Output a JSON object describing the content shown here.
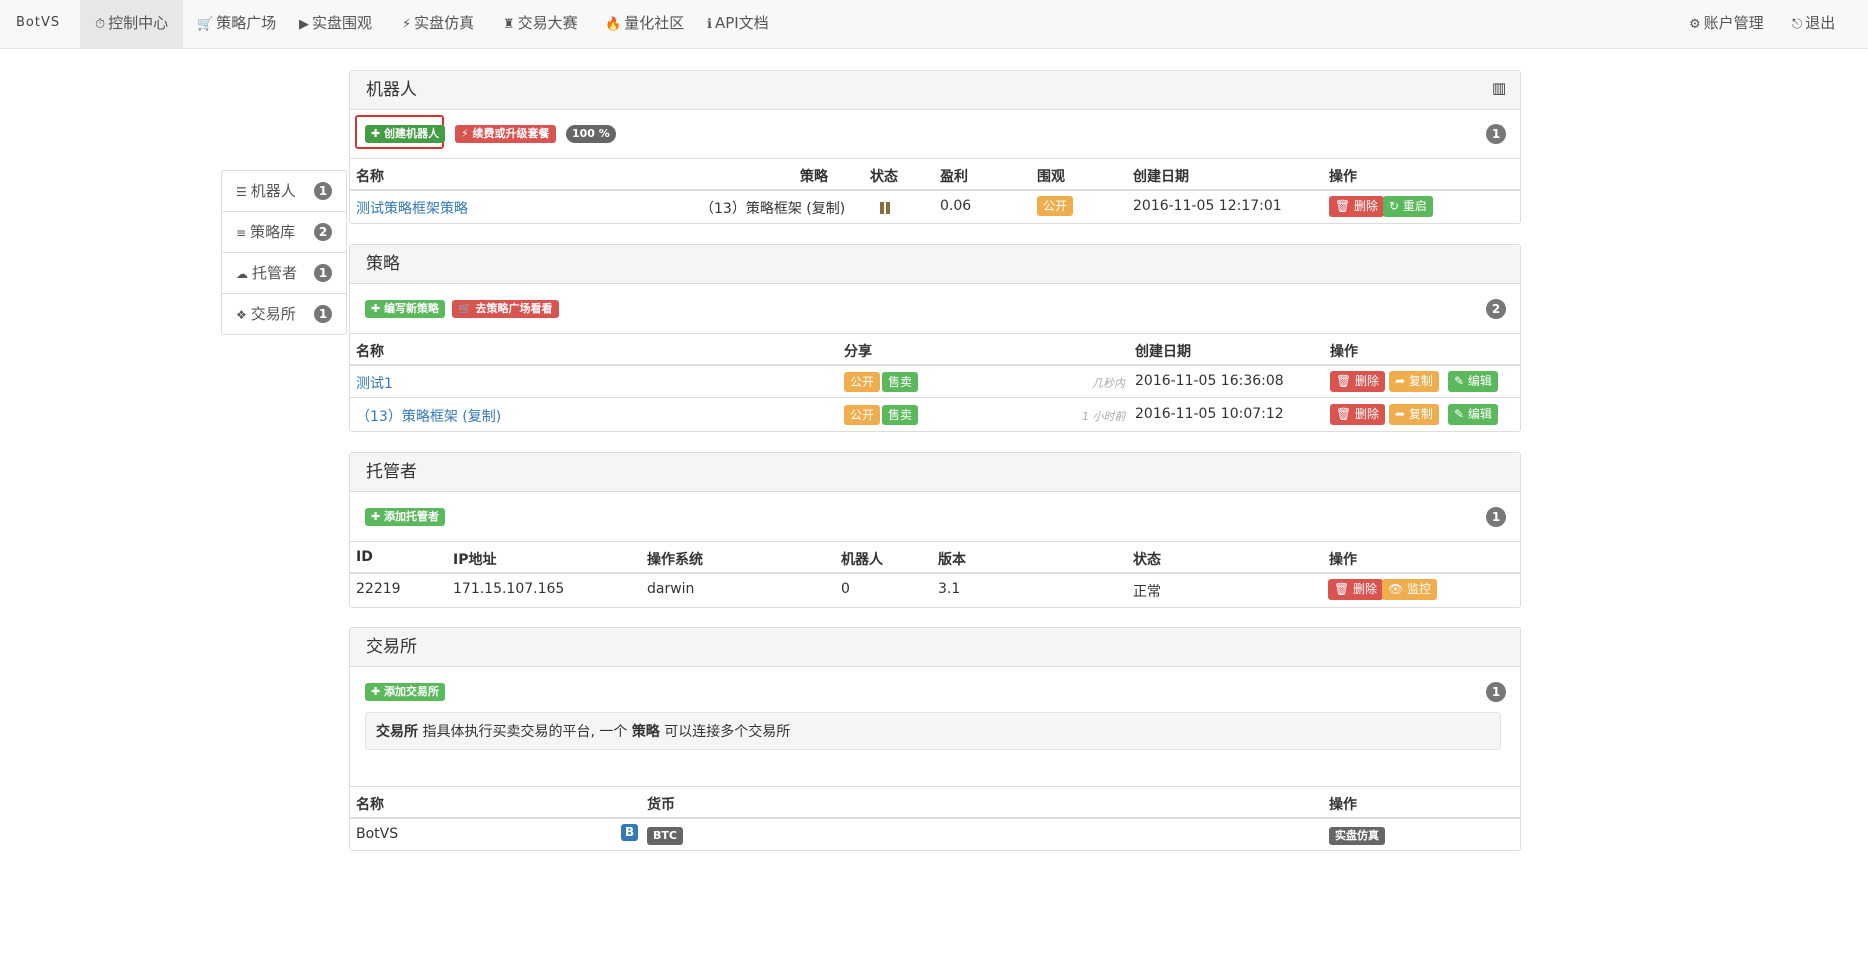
{
  "navbar": {
    "brand": "BotVS",
    "items": [
      {
        "icon": "clock-icon",
        "glyph": "⏱",
        "label": "控制中心"
      },
      {
        "icon": "cart-icon",
        "glyph": "🛒",
        "label": "策略广场"
      },
      {
        "icon": "play-circle-icon",
        "glyph": "▶",
        "label": "实盘围观"
      },
      {
        "icon": "flash-icon",
        "glyph": "⚡",
        "label": "实盘仿真"
      },
      {
        "icon": "tower-icon",
        "glyph": "♜",
        "label": "交易大赛"
      },
      {
        "icon": "fire-icon",
        "glyph": "🔥",
        "label": "量化社区"
      },
      {
        "icon": "info-icon",
        "glyph": "ℹ",
        "label": "API文档"
      }
    ],
    "right": [
      {
        "icon": "gear-icon",
        "glyph": "⚙",
        "label": "账户管理"
      },
      {
        "icon": "logout-icon",
        "glyph": "⎋",
        "label": "退出"
      }
    ]
  },
  "sidebar": {
    "items": [
      {
        "icon": "tasks-icon",
        "glyph": "☰",
        "label": "机器人",
        "count": "1"
      },
      {
        "icon": "database-icon",
        "glyph": "≡",
        "label": "策略库",
        "count": "2"
      },
      {
        "icon": "cloud-icon",
        "glyph": "☁",
        "label": "托管者",
        "count": "1"
      },
      {
        "icon": "cubes-icon",
        "glyph": "❖",
        "label": "交易所",
        "count": "1"
      }
    ]
  },
  "robots": {
    "title": "机器人",
    "create_btn": "✚ 创建机器人",
    "renew_btn": "⚡ 续费或升级套餐",
    "percent": "100 %",
    "count": "1",
    "headers": {
      "name": "名称",
      "strategy": "策略",
      "status": "状态",
      "profit": "盈利",
      "watch": "围观",
      "created": "创建日期",
      "ops": "操作"
    },
    "row": {
      "name": "测试策略框架策略",
      "strategy": "（13）策略框架 (复制)",
      "profit": "0.06",
      "watch": "公开",
      "created": "2016-11-05 12:17:01",
      "delete": "🗑 删除",
      "restart": "↻ 重启"
    }
  },
  "strategies": {
    "title": "策略",
    "new_btn": "✚ 编写新策略",
    "market_btn": "🛒 去策略广场看看",
    "count": "2",
    "headers": {
      "name": "名称",
      "share": "分享",
      "created": "创建日期",
      "ops": "操作"
    },
    "rows": [
      {
        "name": "测试1",
        "public": "公开",
        "sell": "售卖",
        "ago": "几秒内",
        "created": "2016-11-05 16:36:08",
        "delete": "🗑 删除",
        "copy": "➦ 复制",
        "edit": "✎ 编辑"
      },
      {
        "name": "（13）策略框架 (复制)",
        "public": "公开",
        "sell": "售卖",
        "ago": "1 小时前",
        "created": "2016-11-05 10:07:12",
        "delete": "🗑 删除",
        "copy": "➦ 复制",
        "edit": "✎ 编辑"
      }
    ]
  },
  "hosts": {
    "title": "托管者",
    "add_btn": "✚ 添加托管者",
    "count": "1",
    "headers": {
      "id": "ID",
      "ip": "IP地址",
      "os": "操作系统",
      "robots": "机器人",
      "version": "版本",
      "status": "状态",
      "ops": "操作"
    },
    "row": {
      "id": "22219",
      "ip": "171.15.107.165",
      "os": "darwin",
      "robots": "0",
      "version": "3.1",
      "status": "正常",
      "delete": "🗑 删除",
      "monitor": "👁 监控"
    }
  },
  "exchanges": {
    "title": "交易所",
    "add_btn": "✚ 添加交易所",
    "count": "1",
    "info_a": "交易所",
    "info_b": " 指具体执行买卖交易的平台, 一个 ",
    "info_c": "策略",
    "info_d": " 可以连接多个交易所",
    "headers": {
      "name": "名称",
      "currency": "货币",
      "ops": "操作"
    },
    "row": {
      "name": "BotVS",
      "b_icon": "B",
      "currency": "BTC",
      "op": "实盘仿真"
    }
  },
  "colors": {
    "primary": "#337ab7",
    "success": "#5cb85c",
    "danger": "#d9534f",
    "warning": "#f0ad4e"
  }
}
